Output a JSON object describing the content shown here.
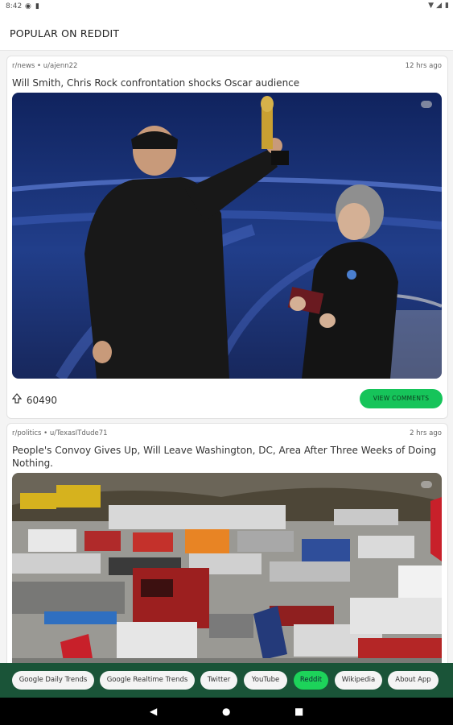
{
  "status": {
    "time": "8:42"
  },
  "header": {
    "title": "POPULAR ON REDDIT"
  },
  "posts": [
    {
      "meta": "r/news • u/ajenn22",
      "time": "12 hrs ago",
      "title": "Will Smith, Chris Rock confrontation shocks Oscar audience",
      "votes": "60490",
      "button": "VIEW COMMENTS"
    },
    {
      "meta": "r/politics • u/TexasITdude71",
      "time": "2 hrs ago",
      "title": "People's Convoy Gives Up, Will Leave Washington, DC, Area After Three Weeks of Doing Nothing."
    }
  ],
  "tabs": [
    {
      "label": "Google Daily Trends",
      "active": false
    },
    {
      "label": "Google Realtime Trends",
      "active": false
    },
    {
      "label": "Twitter",
      "active": false
    },
    {
      "label": "YouTube",
      "active": false
    },
    {
      "label": "Reddit",
      "active": true
    },
    {
      "label": "Wikipedia",
      "active": false
    },
    {
      "label": "About App",
      "active": false
    }
  ],
  "icons": {
    "upvote": "arrow-up-icon",
    "back": "back-icon",
    "home": "home-icon",
    "recents": "recents-icon"
  },
  "colors": {
    "accent": "#16c45a",
    "tabbar": "#1a5438"
  }
}
